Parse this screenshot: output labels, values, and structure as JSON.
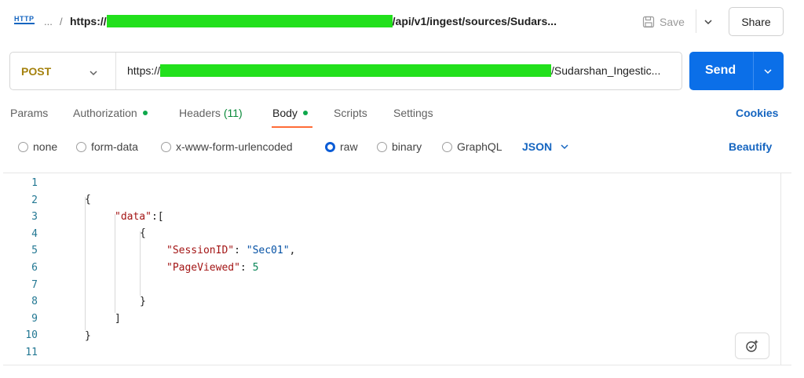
{
  "header": {
    "protocol": "HTTP",
    "crumb_dots": "...",
    "crumb_sep": "/",
    "url_prefix": "https://",
    "url_suffix": "/api/v1/ingest/sources/Sudars...",
    "save_label": "Save",
    "share_label": "Share"
  },
  "request": {
    "method": "POST",
    "url_prefix": "https://",
    "url_suffix": "/Sudarshan_Ingestic...",
    "send_label": "Send"
  },
  "tabs": {
    "params": "Params",
    "authorization": "Authorization",
    "headers": "Headers",
    "headers_count": "(11)",
    "body": "Body",
    "scripts": "Scripts",
    "settings": "Settings",
    "cookies": "Cookies"
  },
  "body_options": {
    "none": "none",
    "form_data": "form-data",
    "urlencoded": "x-www-form-urlencoded",
    "raw": "raw",
    "binary": "binary",
    "graphql": "GraphQL",
    "format": "JSON",
    "beautify": "Beautify"
  },
  "editor": {
    "line_numbers": [
      "1",
      "2",
      "3",
      "4",
      "5",
      "6",
      "7",
      "8",
      "9",
      "10",
      "11"
    ],
    "open_brace": "{",
    "close_brace": "}",
    "data_key": "\"data\"",
    "colon_bracket": ":[",
    "close_bracket": "]",
    "session_key": "\"SessionID\"",
    "session_value": "\"Sec01\"",
    "page_key": "\"PageViewed\"",
    "page_value": "5",
    "colon_space": ": ",
    "comma": ","
  },
  "colors": {
    "send": "#0b6fe8",
    "method": "#a5820e",
    "active_tab_underline": "#ff6c37",
    "link": "#1565c0"
  }
}
